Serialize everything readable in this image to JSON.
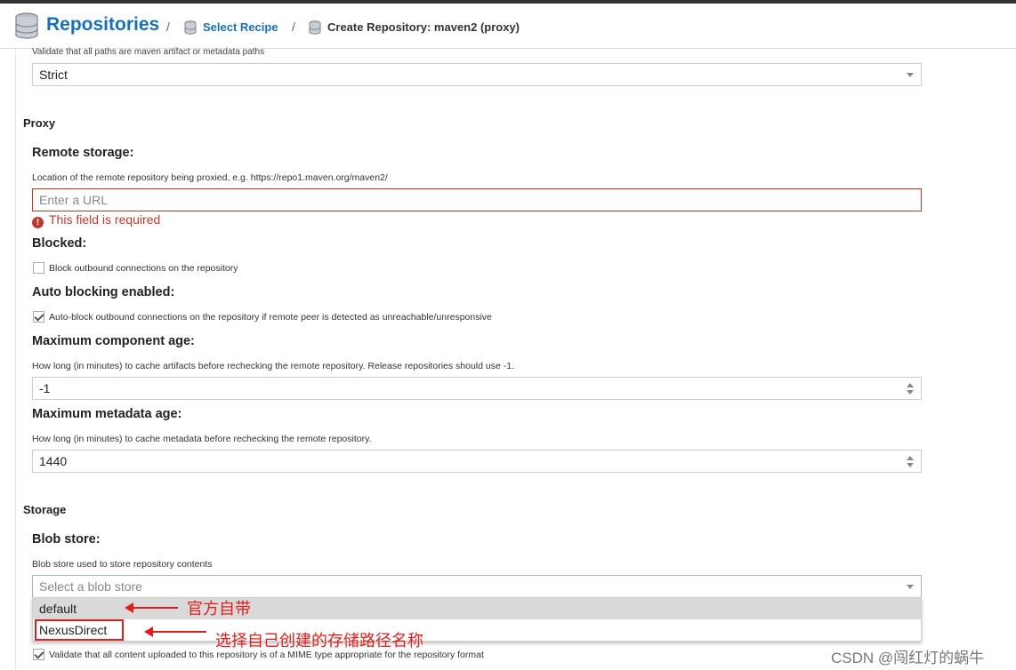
{
  "header": {
    "title": "Repositories",
    "breadcrumb_sep": "/",
    "crumb_select_recipe": "Select Recipe",
    "crumb_current": "Create Repository: maven2 (proxy)"
  },
  "top_cut": {
    "help": "Validate that all paths are maven artifact or metadata paths",
    "value": "Strict"
  },
  "proxy": {
    "section_title": "Proxy",
    "remote_storage": {
      "label": "Remote storage:",
      "help": "Location of the remote repository being proxied, e.g. https://repo1.maven.org/maven2/",
      "placeholder": "Enter a URL",
      "error": "This field is required",
      "error_icon": "!"
    },
    "blocked": {
      "label": "Blocked:",
      "checkbox_label": "Block outbound connections on the repository"
    },
    "auto_blocking": {
      "label": "Auto blocking enabled:",
      "checkbox_label": "Auto-block outbound connections on the repository if remote peer is detected as unreachable/unresponsive"
    },
    "max_component_age": {
      "label": "Maximum component age:",
      "help": "How long (in minutes) to cache artifacts before rechecking the remote repository. Release repositories should use -1.",
      "value": "-1"
    },
    "max_metadata_age": {
      "label": "Maximum metadata age:",
      "help": "How long (in minutes) to cache metadata before rechecking the remote repository.",
      "value": "1440"
    }
  },
  "storage": {
    "section_title": "Storage",
    "blob_store": {
      "label": "Blob store:",
      "help": "Blob store used to store repository contents",
      "placeholder": "Select a blob store",
      "options": [
        "default",
        "NexusDirect"
      ]
    },
    "strict_content_label": "Validate that all content uploaded to this repository is of a MIME type appropriate for the repository format"
  },
  "annotations": {
    "default_note": "官方自带",
    "nexusdirect_note": "选择自己创建的存储路径名称"
  },
  "watermark": "CSDN @闯红灯的蜗牛",
  "colors": {
    "brand_blue": "#1a6fb5",
    "error_red": "#c0392b",
    "annotation_red": "#e02020"
  },
  "icons": {
    "header": "database-icon",
    "crumb": "database-icon",
    "caret": "chevron-down-icon",
    "spinner": "spinner-arrows-icon",
    "error": "exclamation-circle-icon"
  }
}
